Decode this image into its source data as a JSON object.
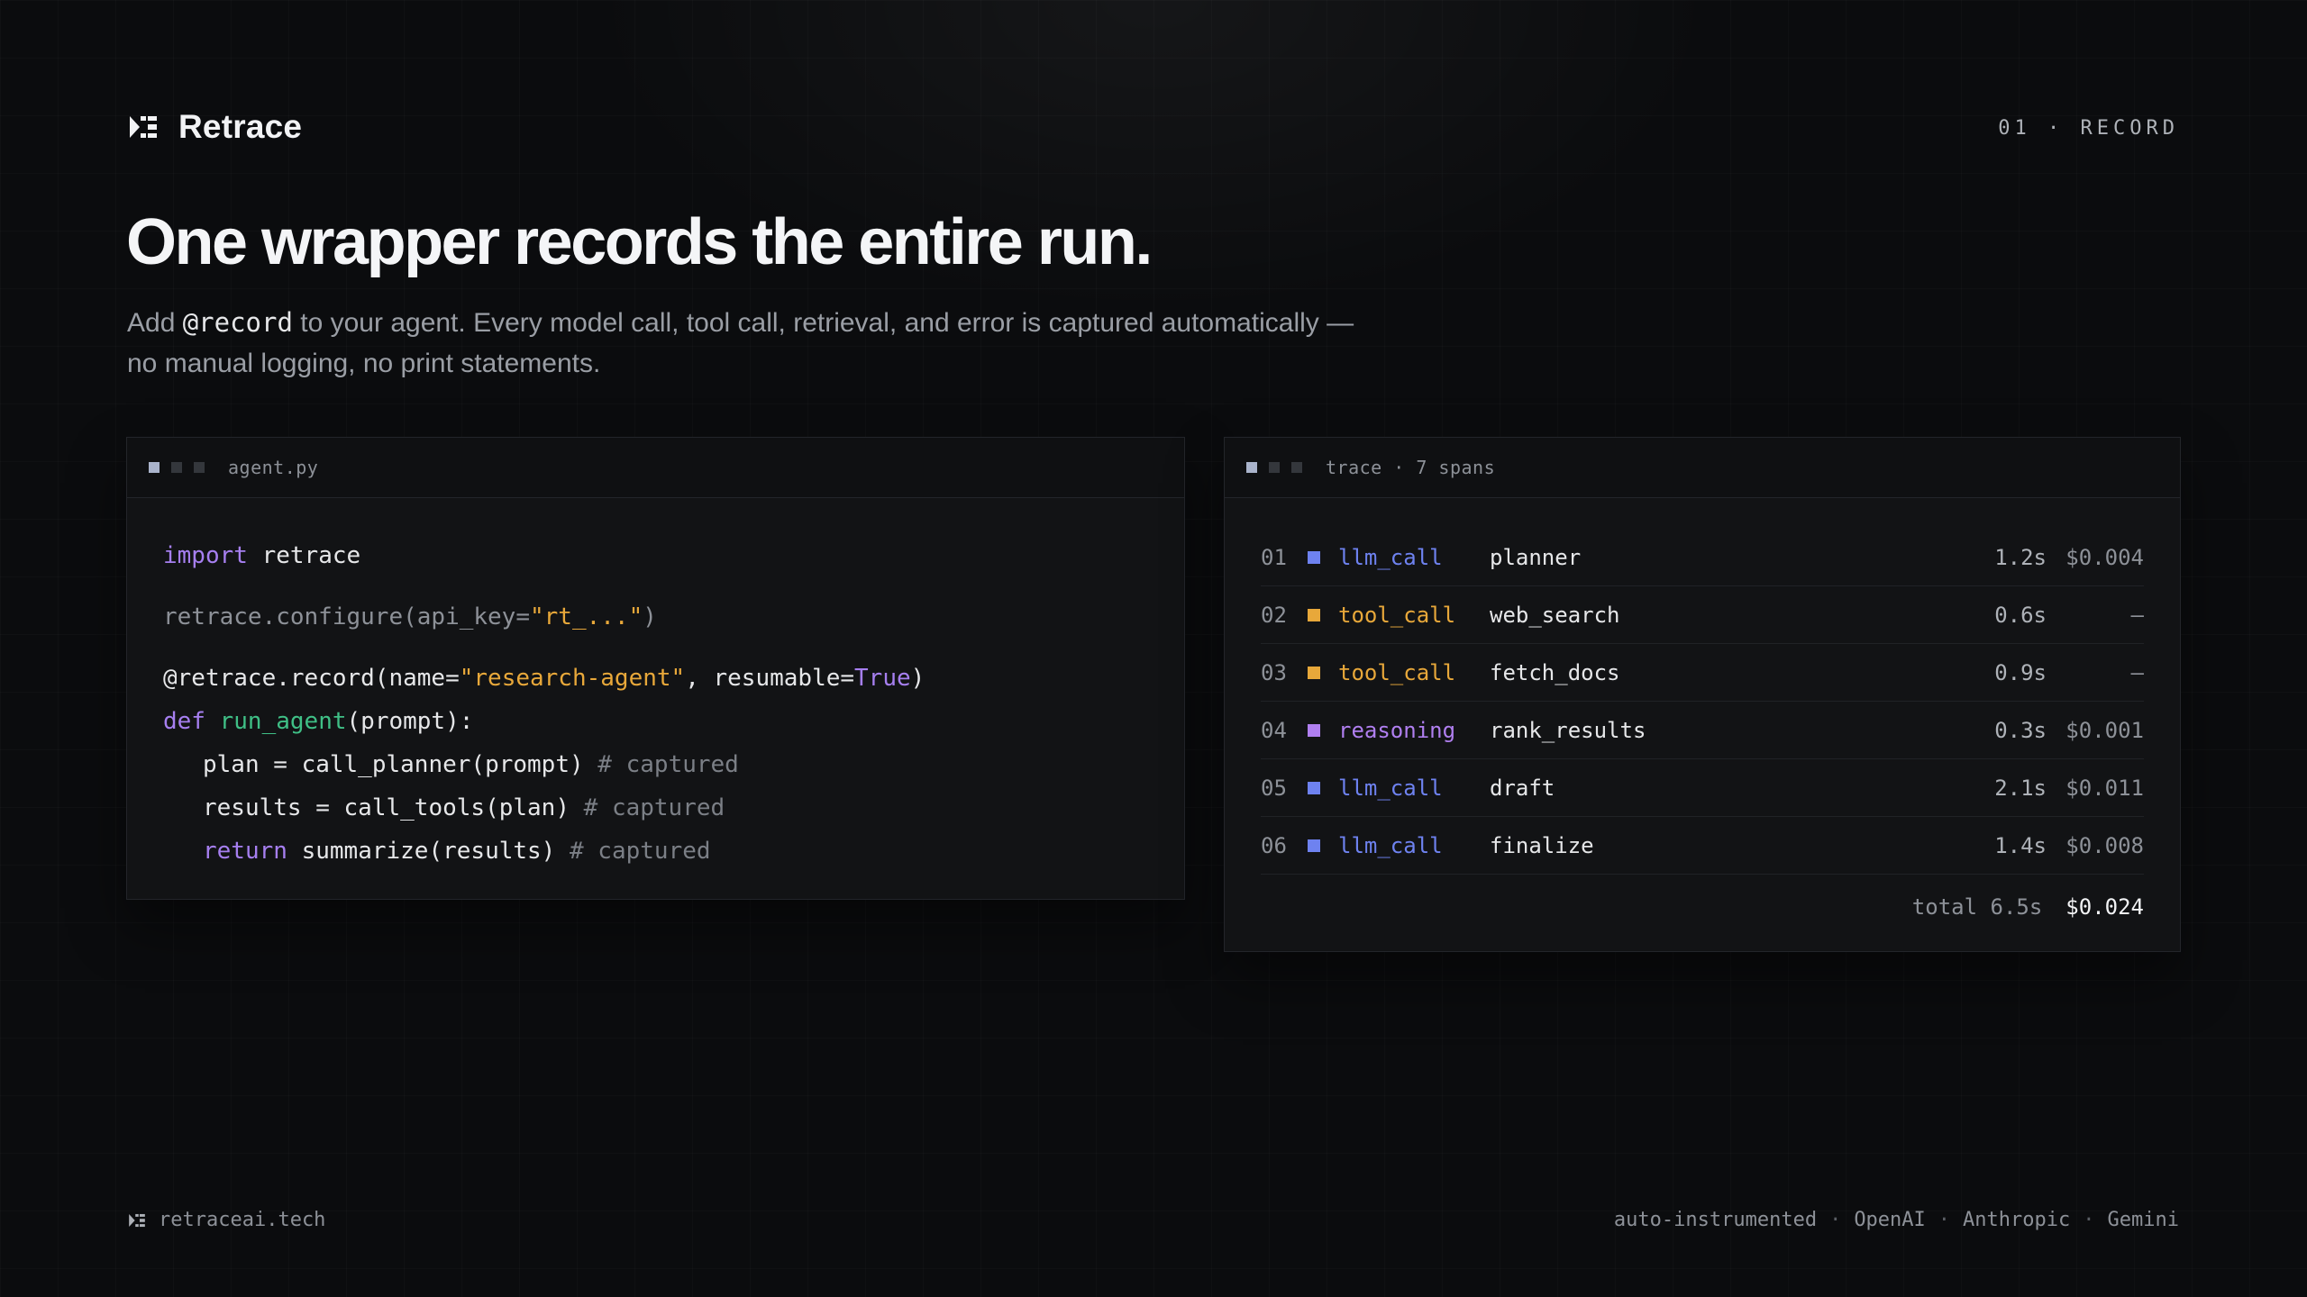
{
  "header": {
    "brand": "Retrace",
    "slide_tag": "01 · RECORD"
  },
  "hero": {
    "headline": "One wrapper records the entire run.",
    "sub_prefix": "Add ",
    "sub_code": "@record",
    "sub_suffix": " to your agent. Every model call, tool call, retrieval, and error is captured automatically —",
    "sub_line2": "no manual logging, no print statements."
  },
  "code_panel": {
    "filename": "agent.py",
    "lines": {
      "import_kw": "import",
      "import_mod": " retrace",
      "configure_pre": "retrace.configure(api_key=",
      "configure_str": "\"rt_...\"",
      "configure_post": ")",
      "decorator_pre": "@retrace.record(name=",
      "decorator_str": "\"research-agent\"",
      "decorator_mid": ", resumable=",
      "decorator_bool": "True",
      "decorator_post": ")",
      "def_kw": "def",
      "def_fn": "run_agent",
      "def_args": "(prompt):",
      "plan": "plan = call_planner(prompt) ",
      "plan_cm": "# captured",
      "results": "results = call_tools(plan) ",
      "results_cm": "# captured",
      "return_kw": "return",
      "return_rest": " summarize(results) ",
      "return_cm": "# captured"
    }
  },
  "trace_panel": {
    "title": "trace · 7 spans",
    "rows": [
      {
        "idx": "01",
        "kind": "llm_call",
        "name": "planner",
        "dur": "1.2s",
        "cost": "$0.004"
      },
      {
        "idx": "02",
        "kind": "tool_call",
        "name": "web_search",
        "dur": "0.6s",
        "cost": "—"
      },
      {
        "idx": "03",
        "kind": "tool_call",
        "name": "fetch_docs",
        "dur": "0.9s",
        "cost": "—"
      },
      {
        "idx": "04",
        "kind": "reasoning",
        "name": "rank_results",
        "dur": "0.3s",
        "cost": "$0.001"
      },
      {
        "idx": "05",
        "kind": "llm_call",
        "name": "draft",
        "dur": "2.1s",
        "cost": "$0.011"
      },
      {
        "idx": "06",
        "kind": "llm_call",
        "name": "finalize",
        "dur": "1.4s",
        "cost": "$0.008"
      }
    ],
    "total_label": "total 6.5s",
    "total_cost": "$0.024"
  },
  "footer": {
    "site": "retraceai.tech",
    "tags": [
      "auto-instrumented",
      "OpenAI",
      "Anthropic",
      "Gemini"
    ],
    "separator": "·"
  },
  "colors": {
    "llm_call": "#6e82f0",
    "tool_call": "#e8a83a",
    "reasoning": "#b07ff0",
    "background": "#0b0c0e"
  },
  "icons": {
    "brand": "retrace-logo-icon"
  }
}
